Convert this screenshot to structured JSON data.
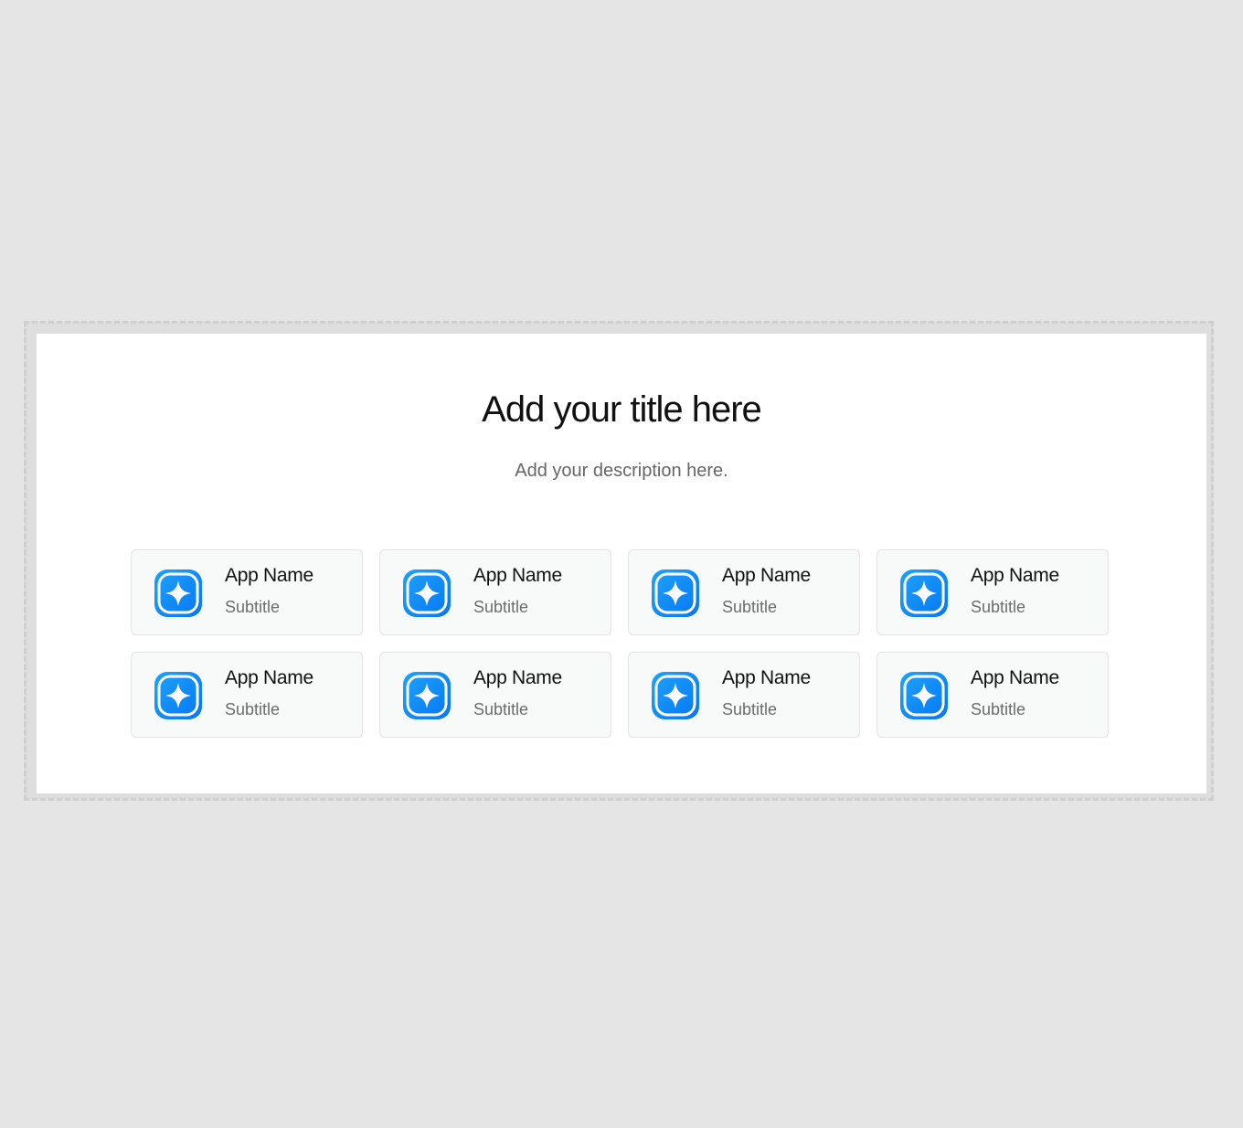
{
  "header": {
    "title": "Add your title here",
    "description": "Add your description here."
  },
  "colors": {
    "accent": "#0a84ff",
    "background": "#e5e5e5",
    "panel": "#ffffff",
    "card": "#f8f9f9"
  },
  "apps": [
    {
      "name": "App Name",
      "subtitle": "Subtitle",
      "icon": "sparkle-app-icon"
    },
    {
      "name": "App Name",
      "subtitle": "Subtitle",
      "icon": "sparkle-app-icon"
    },
    {
      "name": "App Name",
      "subtitle": "Subtitle",
      "icon": "sparkle-app-icon"
    },
    {
      "name": "App Name",
      "subtitle": "Subtitle",
      "icon": "sparkle-app-icon"
    },
    {
      "name": "App Name",
      "subtitle": "Subtitle",
      "icon": "sparkle-app-icon"
    },
    {
      "name": "App Name",
      "subtitle": "Subtitle",
      "icon": "sparkle-app-icon"
    },
    {
      "name": "App Name",
      "subtitle": "Subtitle",
      "icon": "sparkle-app-icon"
    },
    {
      "name": "App Name",
      "subtitle": "Subtitle",
      "icon": "sparkle-app-icon"
    }
  ]
}
